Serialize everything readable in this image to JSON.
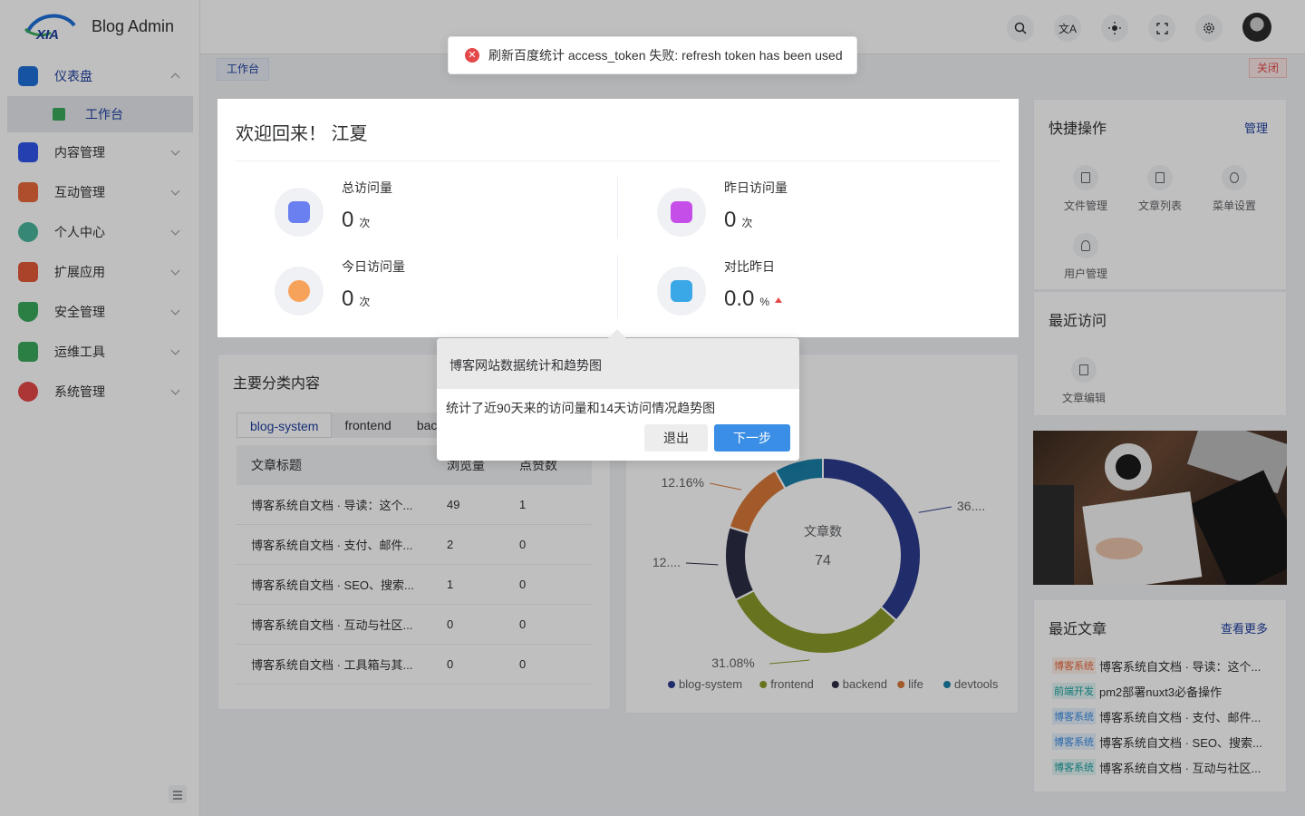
{
  "app": {
    "title": "Blog Admin",
    "logo_text": "XIA"
  },
  "sidebar": {
    "items": [
      {
        "label": "仪表盘",
        "icon": "monitor-icon",
        "color": "#1e6fd9"
      },
      {
        "label": "内容管理",
        "icon": "document-icon",
        "color": "#2f54eb"
      },
      {
        "label": "互动管理",
        "icon": "comment-icon",
        "color": "#e8683c"
      },
      {
        "label": "个人中心",
        "icon": "user-icon",
        "color": "#49b59b"
      },
      {
        "label": "扩展应用",
        "icon": "flag-icon",
        "color": "#e55a3a"
      },
      {
        "label": "安全管理",
        "icon": "shield-icon",
        "color": "#3aaa5c"
      },
      {
        "label": "运维工具",
        "icon": "server-icon",
        "color": "#3aaa5c"
      },
      {
        "label": "系统管理",
        "icon": "gear-icon",
        "color": "#e54848"
      }
    ],
    "sub_item": {
      "label": "工作台"
    }
  },
  "tabs": {
    "work": "工作台",
    "close": "关闭"
  },
  "toast": {
    "message": "刷新百度统计 access_token 失败: refresh token has been used"
  },
  "welcome": {
    "title": "欢迎回来！ 江夏",
    "stats": [
      {
        "label": "总访问量",
        "value": "0",
        "unit": "次"
      },
      {
        "label": "昨日访问量",
        "value": "0",
        "unit": "次"
      },
      {
        "label": "今日访问量",
        "value": "0",
        "unit": "次"
      },
      {
        "label": "对比昨日",
        "value": "0.0",
        "unit": "%"
      }
    ]
  },
  "category": {
    "title": "主要分类内容",
    "tabs": [
      "blog-system",
      "frontend",
      "bac"
    ],
    "columns": [
      "文章标题",
      "浏览量",
      "点赞数"
    ],
    "rows": [
      [
        "博客系统自文档 · 导读：这个...",
        "49",
        "1"
      ],
      [
        "博客系统自文档 · 支付、邮件...",
        "2",
        "0"
      ],
      [
        "博客系统自文档 · SEO、搜索...",
        "1",
        "0"
      ],
      [
        "博客系统自文档 · 互动与社区...",
        "0",
        "0"
      ],
      [
        "博客系统自文档 · 工具箱与其...",
        "0",
        "0"
      ]
    ]
  },
  "chart_data": {
    "type": "pie",
    "center_label": "文章数",
    "center_value": "74",
    "categories": [
      "blog-system",
      "frontend",
      "backend",
      "life",
      "devtools"
    ],
    "values": [
      36.49,
      31.08,
      12.16,
      12.16,
      8.11
    ],
    "labels": [
      "36....",
      "31.08%",
      "12....",
      "12.16%",
      ""
    ],
    "colors": [
      "#2d3d8f",
      "#8a9a2a",
      "#2b2d45",
      "#d9793a",
      "#1a7fa8"
    ]
  },
  "quick": {
    "title": "快捷操作",
    "manage": "管理",
    "items": [
      "文件管理",
      "文章列表",
      "菜单设置",
      "用户管理"
    ]
  },
  "recent": {
    "title": "最近访问",
    "items": [
      "文章编辑"
    ]
  },
  "articles": {
    "title": "最近文章",
    "more": "查看更多",
    "items": [
      {
        "tag": "博客系统",
        "tag_color": "#e8683c",
        "title": "博客系统自文档 · 导读：这个..."
      },
      {
        "tag": "前端开发",
        "tag_color": "#1aa0a0",
        "title": "pm2部署nuxt3必备操作"
      },
      {
        "tag": "博客系统",
        "tag_color": "#3a8ee6",
        "title": "博客系统自文档 · 支付、邮件..."
      },
      {
        "tag": "博客系统",
        "tag_color": "#3a8ee6",
        "title": "博客系统自文档 · SEO、搜索..."
      },
      {
        "tag": "博客系统",
        "tag_color": "#1aa0a0",
        "title": "博客系统自文档 · 互动与社区..."
      }
    ]
  },
  "tour": {
    "title": "博客网站数据统计和趋势图",
    "body": "统计了近90天来的访问量和14天访问情况趋势图",
    "exit": "退出",
    "next": "下一步"
  }
}
